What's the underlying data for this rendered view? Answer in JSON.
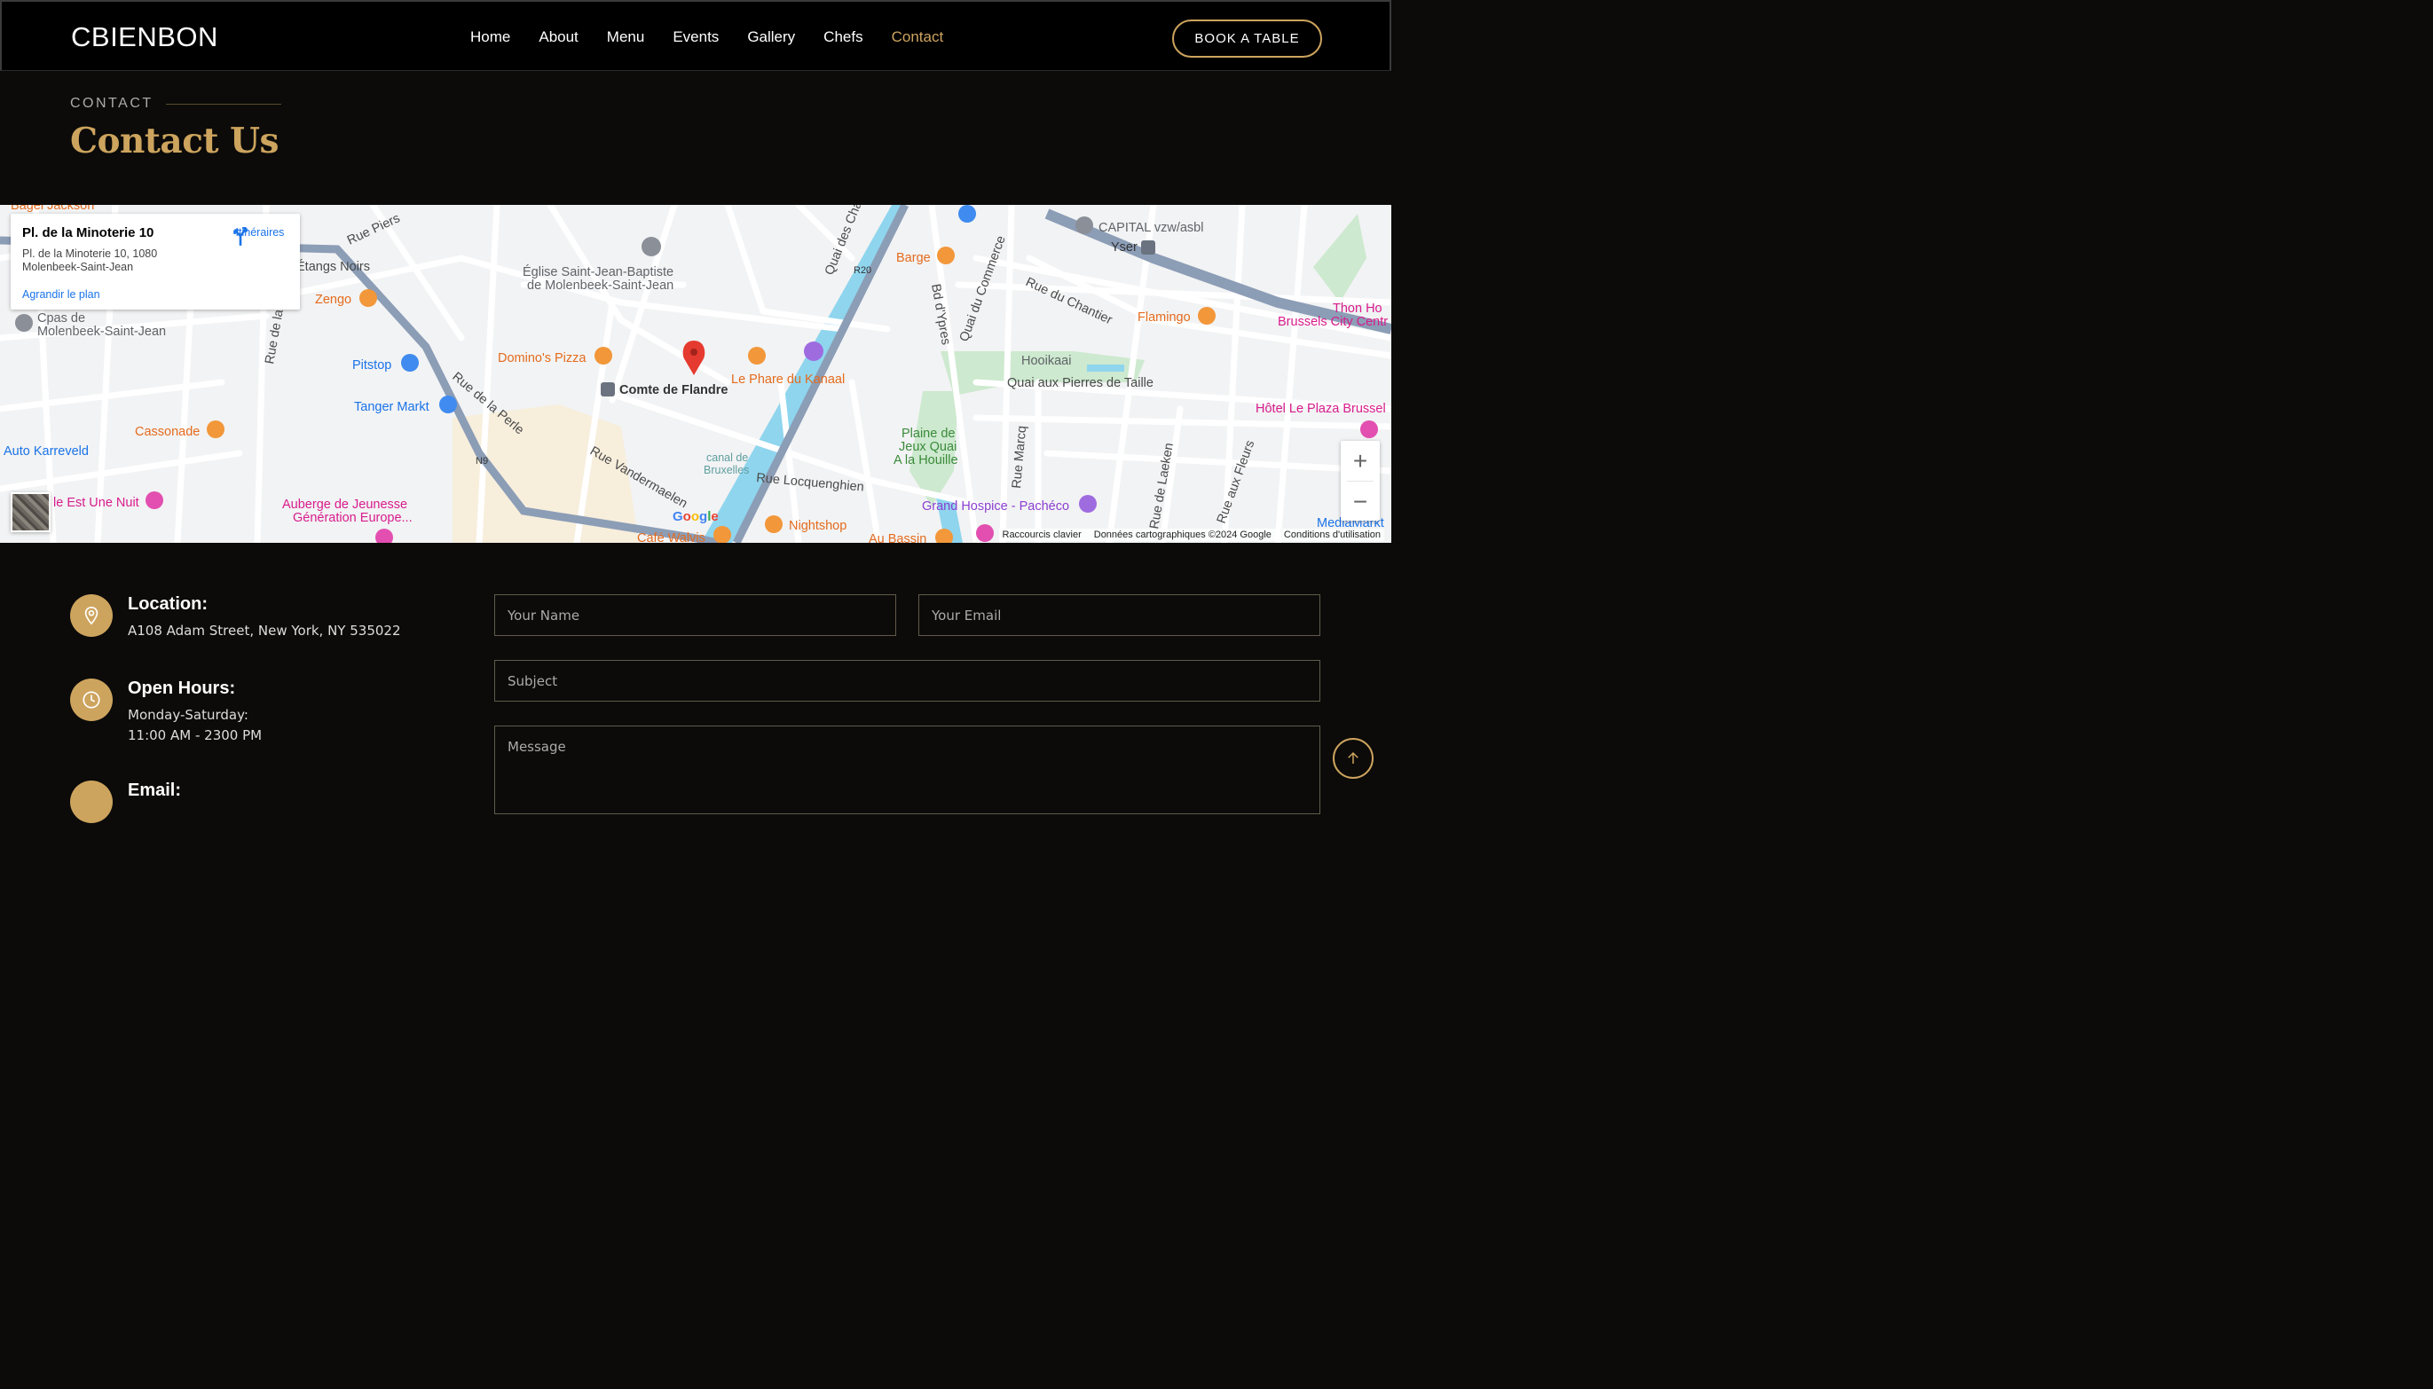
{
  "header": {
    "logo": "CBIENBON",
    "nav": [
      "Home",
      "About",
      "Menu",
      "Events",
      "Gallery",
      "Chefs",
      "Contact"
    ],
    "active_nav": "Contact",
    "book_label": "BOOK A TABLE"
  },
  "section": {
    "eyebrow": "CONTACT",
    "title": "Contact Us"
  },
  "map": {
    "place_title": "Pl. de la Minoterie 10",
    "address_line1": "Pl. de la Minoterie 10, 1080",
    "address_line2": "Molenbeek-Saint-Jean",
    "enlarge_label": "Agrandir le plan",
    "directions_label": "Itinéraires",
    "zoom_in": "+",
    "zoom_out": "−",
    "google_logo": "Google",
    "attribution": [
      "Raccourcis clavier",
      "Données cartographiques ©2024 Google",
      "Conditions d'utilisation"
    ],
    "labels": {
      "bagel": "Bagel Jackson",
      "etangs": "Étangs Noirs",
      "zengo": "Zengo",
      "cpas1": "Cpas de",
      "cpas2": "Molenbeek-Saint-Jean",
      "pitstop": "Pitstop",
      "tanger": "Tanger Markt",
      "cassonade": "Cassonade",
      "auto": "Auto Karreveld",
      "ile": "le Est Une Nuit",
      "auberge1": "Auberge de Jeunesse",
      "auberge2": "Génération Europe...",
      "eglise1": "Église Saint-Jean-Baptiste",
      "eglise2": "de Molenbeek-Saint-Jean",
      "dominos": "Domino's Pizza",
      "comte": "Comte de Flandre",
      "phare": "Le Phare du Kanaal",
      "canal1": "canal de",
      "canal2": "Bruxelles",
      "locquenghien": "Rue Locquenghien",
      "vandermaelen": "Rue Vandermaelen",
      "perle": "Rue de la Perle",
      "piers": "Rue Piers",
      "ruedela": "Rue de la",
      "walvis": "Café Walvis",
      "nightshop": "Nightshop",
      "bassin": "Au Bassin",
      "barge": "Barge",
      "quai_charbon": "Quai des Char...",
      "r20": "R20",
      "n9": "N9",
      "bd_ypres": "Bd d'Ypres",
      "quai_commerce": "Quai du Commerce",
      "chantier": "Rue du Chantier",
      "capital": "CAPITAL vzw/asbl",
      "yser": "Yser",
      "flamingo": "Flamingo",
      "hooikaai": "Hooikaai",
      "pierres": "Quai aux Pierres de Taille",
      "plaine1": "Plaine de",
      "plaine2": "Jeux Quai",
      "plaine3": "A la Houille",
      "marcq": "Rue Marcq",
      "hospice": "Grand Hospice - Pachéco",
      "laeken": "Rue de Laeken",
      "fleurs": "Rue aux Fleurs",
      "thon1": "Thon Ho",
      "thon2": "Brussels City Centr",
      "plaza": "Hôtel Le Plaza Brussel",
      "mediamarkt": "MediaMarkt"
    }
  },
  "contact": {
    "location_title": "Location:",
    "location_text": "A108 Adam Street, New York, NY 535022",
    "hours_title": "Open Hours:",
    "hours_line1": "Monday-Saturday:",
    "hours_line2": "11:00 AM - 2300 PM",
    "email_title": "Email:"
  },
  "form": {
    "name_placeholder": "Your Name",
    "email_placeholder": "Your Email",
    "subject_placeholder": "Subject",
    "message_placeholder": "Message"
  },
  "colors": {
    "accent": "#cda45e",
    "background": "#0c0b09",
    "header_bg": "#000000"
  },
  "icons": [
    "location-pin-icon",
    "clock-icon",
    "email-icon",
    "arrow-up-icon",
    "directions-icon",
    "map-marker-icon"
  ]
}
